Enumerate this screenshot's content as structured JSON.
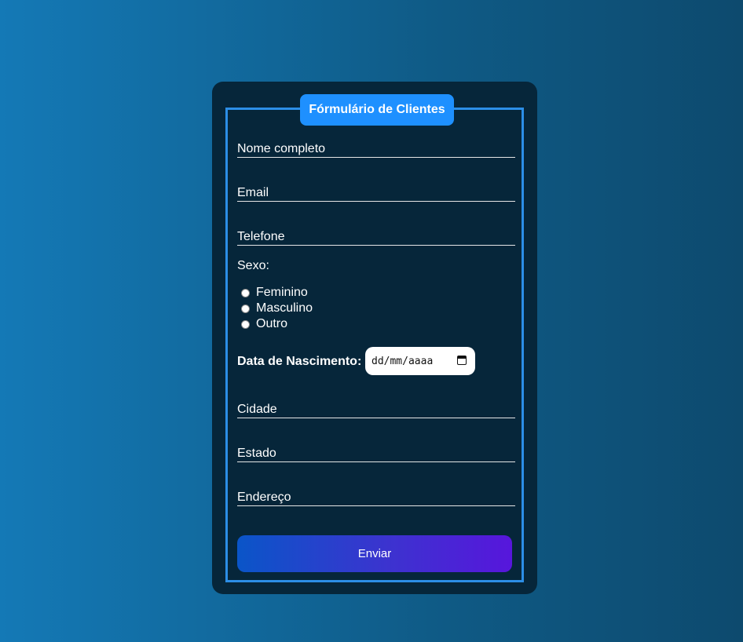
{
  "form": {
    "legend": "Fórmulário de Clientes",
    "fields": {
      "nome": {
        "label": "Nome completo",
        "value": ""
      },
      "email": {
        "label": "Email",
        "value": ""
      },
      "telefone": {
        "label": "Telefone",
        "value": ""
      },
      "cidade": {
        "label": "Cidade",
        "value": ""
      },
      "estado": {
        "label": "Estado",
        "value": ""
      },
      "endereco": {
        "label": "Endereço",
        "value": ""
      }
    },
    "sexo": {
      "label": "Sexo:",
      "options": [
        "Feminino",
        "Masculino",
        "Outro"
      ]
    },
    "nascimento": {
      "label": "Data de Nascimento:",
      "placeholder": "dd/mm/aaaa"
    },
    "submit_label": "Enviar"
  },
  "colors": {
    "background_start": "#1479b6",
    "background_end": "#0d4a6e",
    "card": "#06263a",
    "border": "#2c8ee6",
    "legend": "#1e90ff",
    "button_start": "#0a55c8",
    "button_end": "#5716dc"
  },
  "icons": {
    "calendar": "calendar-icon"
  }
}
